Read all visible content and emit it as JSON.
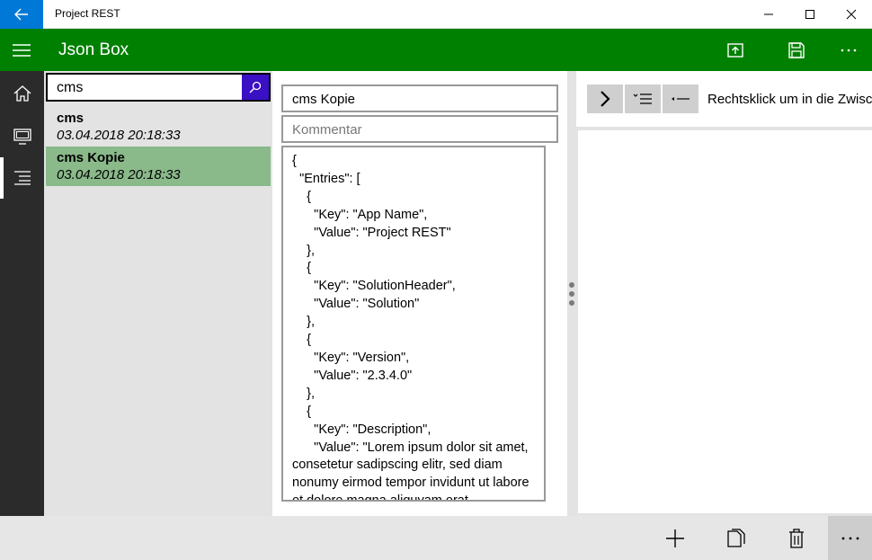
{
  "window": {
    "title": "Project REST"
  },
  "header": {
    "title": "Json Box"
  },
  "search": {
    "value": "cms"
  },
  "list": {
    "items": [
      {
        "name": "cms",
        "date": "03.04.2018 20:18:33"
      },
      {
        "name": "cms Kopie",
        "date": "03.04.2018 20:18:33"
      }
    ]
  },
  "editor": {
    "name_value": "cms Kopie",
    "comment_placeholder": "Kommentar",
    "json_text": "{\n  \"Entries\": [\n    {\n      \"Key\": \"App Name\",\n      \"Value\": \"Project REST\"\n    },\n    {\n      \"Key\": \"SolutionHeader\",\n      \"Value\": \"Solution\"\n    },\n    {\n      \"Key\": \"Version\",\n      \"Value\": \"2.3.4.0\"\n    },\n    {\n      \"Key\": \"Description\",\n      \"Value\": \"Lorem ipsum dolor sit amet, consetetur sadipscing elitr, sed diam nonumy eirmod tempor invidunt ut labore et dolore magna aliquyam erat"
  },
  "rightpane": {
    "hint": "Rechtsklick um in die Zwisch"
  },
  "icons": {
    "back": "back-arrow-icon",
    "minimize": "minimize-icon",
    "maximize": "maximize-icon",
    "close": "close-icon",
    "menu": "hamburger-icon",
    "upload": "upload-icon",
    "save": "save-icon",
    "more": "more-icon",
    "home": "home-icon",
    "monitor": "monitor-icon",
    "list": "list-icon",
    "search": "search-icon",
    "add": "add-icon",
    "copy": "copy-icon",
    "delete": "delete-icon"
  },
  "colors": {
    "accent_green": "#008000",
    "title_back": "#0078d7",
    "search_button": "#3a10c4",
    "selected_item": "#8ab98a",
    "rail": "#2b2b2b"
  }
}
